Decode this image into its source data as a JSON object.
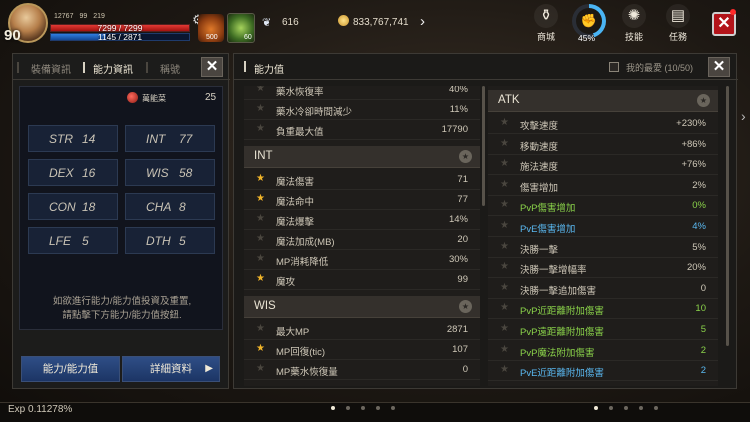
{
  "hud": {
    "level": "90",
    "power": "12767",
    "stat_b": "99",
    "stat_c": "219",
    "hp": "7299 / 7299",
    "hp_fraction": 1.0,
    "mp": "1145 / 2871",
    "mp_fraction": 0.4,
    "potion_count": "500",
    "buff_count": "60",
    "wings_value": "616",
    "gold": "833,767,741",
    "shop_label": "商城",
    "percent_label": "45%",
    "percent_fraction": 0.45,
    "skills_label": "技能",
    "quest_label": "任務",
    "icons": {
      "gear": "gear-icon",
      "wings": "wings-icon",
      "coin": "coin-icon",
      "arrow": "chevron-right-icon",
      "shop": "shop-bag-icon",
      "fist": "fist-icon",
      "skills": "skills-icon",
      "quest": "scroll-icon",
      "close": "close-icon"
    },
    "colors": {
      "hp": "#c81e1a",
      "mp": "#2f7de0",
      "ring": "#4ab4f3",
      "close_bg": "#b3141a"
    }
  },
  "left_panel": {
    "tabs": [
      "裝備資訊",
      "能力資訊",
      "稱號"
    ],
    "active_tab": 1,
    "bonus_label": "萬能菜",
    "bonus_value": "25",
    "stats": [
      {
        "key": "STR",
        "value": "14"
      },
      {
        "key": "INT",
        "value": "77"
      },
      {
        "key": "DEX",
        "value": "16"
      },
      {
        "key": "WIS",
        "value": "58"
      },
      {
        "key": "CON",
        "value": "18"
      },
      {
        "key": "CHA",
        "value": "8"
      },
      {
        "key": "LFE",
        "value": "5"
      },
      {
        "key": "DTH",
        "value": "5"
      }
    ],
    "info_line1": "如欲進行能力/能力值投資及重置,",
    "info_line2": "請點擊下方能力/能力值按鈕.",
    "btn_ability": "能力/能力值",
    "btn_detail": "詳細資料"
  },
  "main_panel": {
    "title": "能力值",
    "favorites_label": "我的最愛 (10/50)",
    "col1_top_rows": [
      {
        "star": false,
        "name": "藥水恢復率",
        "value": "40%"
      },
      {
        "star": false,
        "name": "藥水冷卻時間減少",
        "value": "11%"
      },
      {
        "star": false,
        "name": "負重最大值",
        "value": "17790"
      }
    ],
    "int_section": {
      "title": "INT",
      "rows": [
        {
          "star": true,
          "name": "魔法傷害",
          "value": "71"
        },
        {
          "star": true,
          "name": "魔法命中",
          "value": "77"
        },
        {
          "star": false,
          "name": "魔法爆擊",
          "value": "14%"
        },
        {
          "star": false,
          "name": "魔法加成(MB)",
          "value": "20"
        },
        {
          "star": false,
          "name": "MP消耗降低",
          "value": "30%"
        },
        {
          "star": true,
          "name": "魔攻",
          "value": "99"
        }
      ]
    },
    "wis_section": {
      "title": "WIS",
      "rows": [
        {
          "star": false,
          "name": "最大MP",
          "value": "2871"
        },
        {
          "star": true,
          "name": "MP回復(tic)",
          "value": "107"
        },
        {
          "star": false,
          "name": "MP藥水恢復量",
          "value": "0"
        }
      ]
    },
    "atk_section": {
      "title": "ATK",
      "rows": [
        {
          "star": false,
          "name": "攻擊速度",
          "value": "+230%",
          "color": ""
        },
        {
          "star": false,
          "name": "移動速度",
          "value": "+86%",
          "color": ""
        },
        {
          "star": false,
          "name": "施法速度",
          "value": "+76%",
          "color": ""
        },
        {
          "star": false,
          "name": "傷害增加",
          "value": "2%",
          "color": ""
        },
        {
          "star": false,
          "name": "PvP傷害增加",
          "value": "0%",
          "color": "green"
        },
        {
          "star": false,
          "name": "PvE傷害增加",
          "value": "4%",
          "color": "blue"
        },
        {
          "star": false,
          "name": "決勝一擊",
          "value": "5%",
          "color": ""
        },
        {
          "star": false,
          "name": "決勝一擊增幅率",
          "value": "20%",
          "color": ""
        },
        {
          "star": false,
          "name": "決勝一擊追加傷害",
          "value": "0",
          "color": ""
        },
        {
          "star": false,
          "name": "PvP近距離附加傷害",
          "value": "10",
          "color": "green"
        },
        {
          "star": false,
          "name": "PvP遠距離附加傷害",
          "value": "5",
          "color": "green"
        },
        {
          "star": false,
          "name": "PvP魔法附加傷害",
          "value": "2",
          "color": "green"
        },
        {
          "star": false,
          "name": "PvE近距離附加傷害",
          "value": "2",
          "color": "blue"
        }
      ]
    }
  },
  "bottom": {
    "exp_label": "Exp 0.11278%",
    "dots_left_active": 0,
    "dots_left_count": 5,
    "dots_right_active": 0,
    "dots_right_count": 5
  }
}
